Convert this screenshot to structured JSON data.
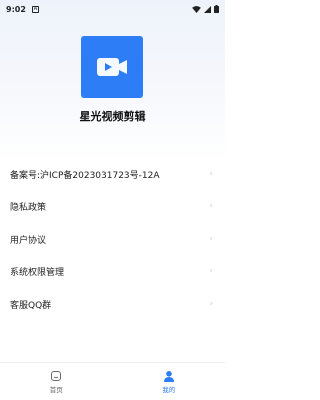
{
  "status_bar": {
    "time": "9:02",
    "notification_badge": "A"
  },
  "app": {
    "name": "星光视频剪辑",
    "logo_icon": "video-camera-icon",
    "brand_color": "#2d7df6"
  },
  "menu": {
    "items": [
      {
        "label": "备案号:沪ICP备2023031723号-12A"
      },
      {
        "label": "隐私政策"
      },
      {
        "label": "用户协议"
      },
      {
        "label": "系统权限管理"
      },
      {
        "label": "客服QQ群"
      }
    ],
    "chevron_icon": "chevron-right-icon"
  },
  "tabbar": {
    "tabs": [
      {
        "label": "首页",
        "icon": "home-icon",
        "active": false
      },
      {
        "label": "我的",
        "icon": "user-icon",
        "active": true
      }
    ],
    "active_color": "#2d7df6"
  }
}
